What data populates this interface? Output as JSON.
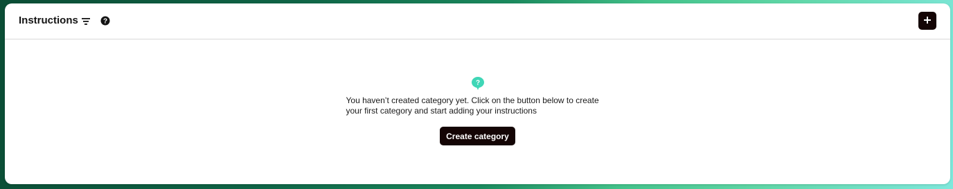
{
  "header": {
    "title": "Instructions",
    "filter_icon": "filter-icon",
    "help_icon": "help-circle-icon",
    "add_icon": "plus-icon"
  },
  "empty_state": {
    "icon": "question-chat-bubble-icon",
    "message": "You haven’t created category yet. Click on the button below to create your first category and start adding your instructions",
    "button_label": "Create category"
  },
  "colors": {
    "accent": "#3fd6b6",
    "button_bg": "#140505",
    "text": "#1a1a1a"
  }
}
